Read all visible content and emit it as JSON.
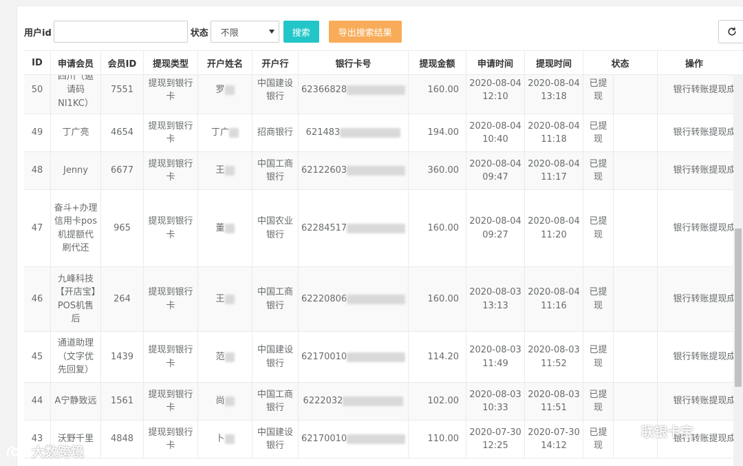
{
  "search": {
    "user_id_label": "用户id",
    "user_id_value": "",
    "status_label": "状态",
    "status_selected": "不限",
    "search_button": "搜索",
    "export_button": "导出搜索结果"
  },
  "table": {
    "columns": [
      "ID",
      "申请会员",
      "会员ID",
      "提现类型",
      "开户姓名",
      "开户行",
      "银行卡号",
      "提现金额",
      "申请时间",
      "提现时间",
      "状态",
      "操作"
    ],
    "rows": [
      {
        "id": "50",
        "member": "四川（邀请码NI1KC）",
        "member_id": "7551",
        "type": "提现到银行卡",
        "name": "罗",
        "bank": "中国建设银行",
        "card": "62366828",
        "amount": "160.00",
        "apply_time": "2020-08-04 12:10",
        "withdraw_time": "2020-08-04 13:18",
        "state": "已提现",
        "action": "银行转账提现成功"
      },
      {
        "id": "49",
        "member": "丁广亮",
        "member_id": "4654",
        "type": "提现到银行卡",
        "name": "丁广",
        "bank": "招商银行",
        "card": "621483",
        "amount": "194.00",
        "apply_time": "2020-08-04 10:40",
        "withdraw_time": "2020-08-04 11:18",
        "state": "已提现",
        "action": "银行转账提现成功"
      },
      {
        "id": "48",
        "member": "Jenny",
        "member_id": "6677",
        "type": "提现到银行卡",
        "name": "王",
        "bank": "中国工商银行",
        "card": "62122603",
        "amount": "360.00",
        "apply_time": "2020-08-04 09:47",
        "withdraw_time": "2020-08-04 11:17",
        "state": "已提现",
        "action": "银行转账提现成功"
      },
      {
        "id": "47",
        "member": "奋斗+办理信用卡pos机提额代刷代还",
        "member_id": "965",
        "type": "提现到银行卡",
        "name": "董",
        "bank": "中国农业银行",
        "card": "62284517",
        "amount": "160.00",
        "apply_time": "2020-08-04 09:27",
        "withdraw_time": "2020-08-04 11:20",
        "state": "已提现",
        "action": "银行转账提现成功"
      },
      {
        "id": "46",
        "member": "九峰科技【开店宝】POS机售后",
        "member_id": "264",
        "type": "提现到银行卡",
        "name": "王",
        "bank": "中国工商银行",
        "card": "62220806",
        "amount": "160.00",
        "apply_time": "2020-08-03 13:13",
        "withdraw_time": "2020-08-04 11:16",
        "state": "已提现",
        "action": "银行转账提现成功"
      },
      {
        "id": "45",
        "member": "通道助理（文字优先回复）",
        "member_id": "1439",
        "type": "提现到银行卡",
        "name": "范",
        "bank": "中国建设银行",
        "card": "62170010",
        "amount": "114.20",
        "apply_time": "2020-08-03 11:49",
        "withdraw_time": "2020-08-03 11:52",
        "state": "已提现",
        "action": "银行转账提现成功"
      },
      {
        "id": "44",
        "member": "A宁静致远",
        "member_id": "1561",
        "type": "提现到银行卡",
        "name": "尚",
        "bank": "中国工商银行",
        "card": "6222032",
        "amount": "102.00",
        "apply_time": "2020-08-03 10:33",
        "withdraw_time": "2020-08-03 11:51",
        "state": "已提现",
        "action": "银行转账提现成功"
      },
      {
        "id": "43",
        "member": "沃野千里",
        "member_id": "4848",
        "type": "提现到银行卡",
        "name": "卜",
        "bank": "中国建设银行",
        "card": "62170010",
        "amount": "110.00",
        "apply_time": "2020-07-30 12:25",
        "withdraw_time": "2020-07-30 14:12",
        "state": "已提现",
        "action": "银行转账提现成功"
      }
    ]
  },
  "watermarks": {
    "left": "大数跨境",
    "right": "联银卡宝"
  },
  "colors": {
    "search_button": "#23c6c8",
    "export_button": "#f8ac59",
    "border": "#e7eaec",
    "text": "#676a6c"
  },
  "icons": {
    "refresh": "refresh-icon",
    "dropdown": "caret-down-icon"
  }
}
